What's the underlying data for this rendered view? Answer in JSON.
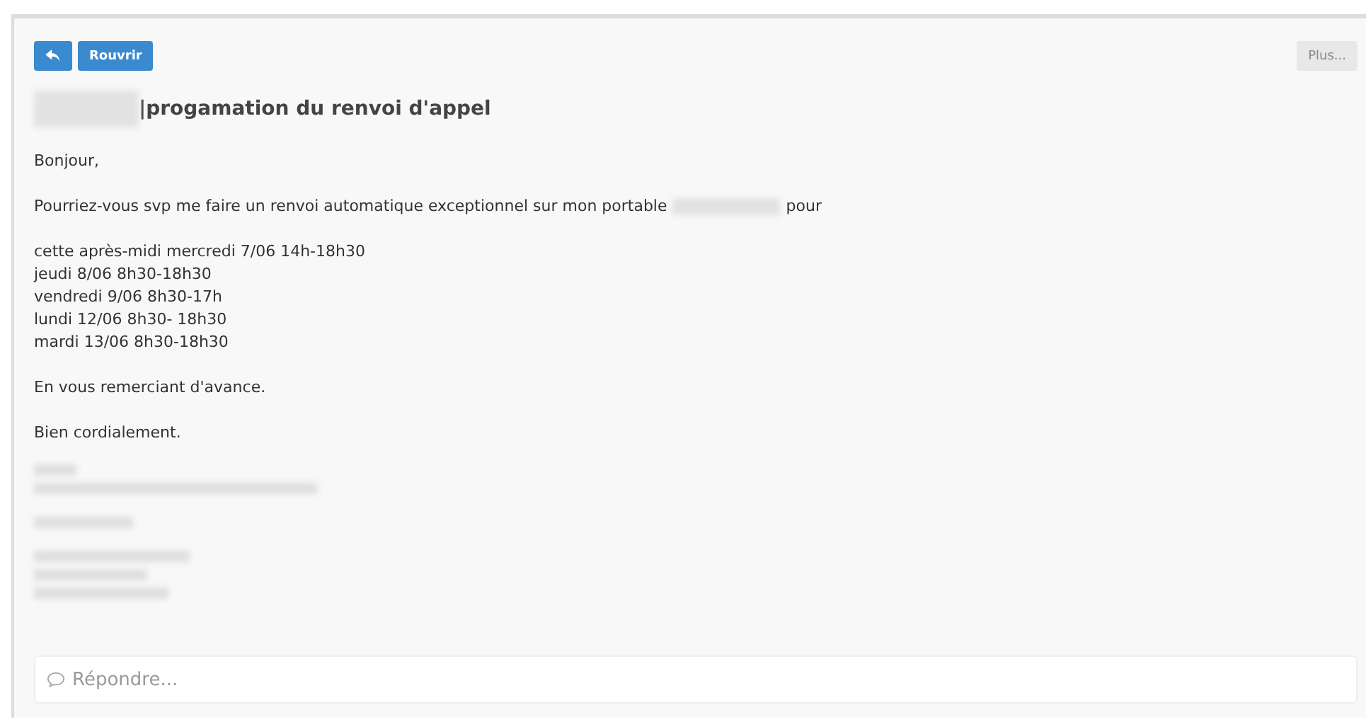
{
  "toolbar": {
    "reopen": "Rouvrir",
    "more": "Plus..."
  },
  "subject": {
    "redacted": true,
    "text": "|progamation du renvoi d'appel"
  },
  "body": [
    {
      "kind": "text",
      "text": "Bonjour,"
    },
    {
      "kind": "redacted_inline",
      "before": "Pourriez-vous svp me faire un renvoi automatique exceptionnel sur mon portable",
      "after": "pour"
    },
    {
      "kind": "lines",
      "lines": [
        "cette après-midi mercredi 7/06 14h-18h30",
        "jeudi 8/06 8h30-18h30",
        "vendredi 9/06 8h30-17h",
        "lundi 12/06 8h30- 18h30",
        "mardi 13/06 8h30-18h30"
      ]
    },
    {
      "kind": "text",
      "text": "En vous remerciant d'avance."
    },
    {
      "kind": "text",
      "text": "Bien cordialement."
    },
    {
      "kind": "signature_redacted"
    }
  ],
  "reply": {
    "placeholder": "Répondre..."
  }
}
